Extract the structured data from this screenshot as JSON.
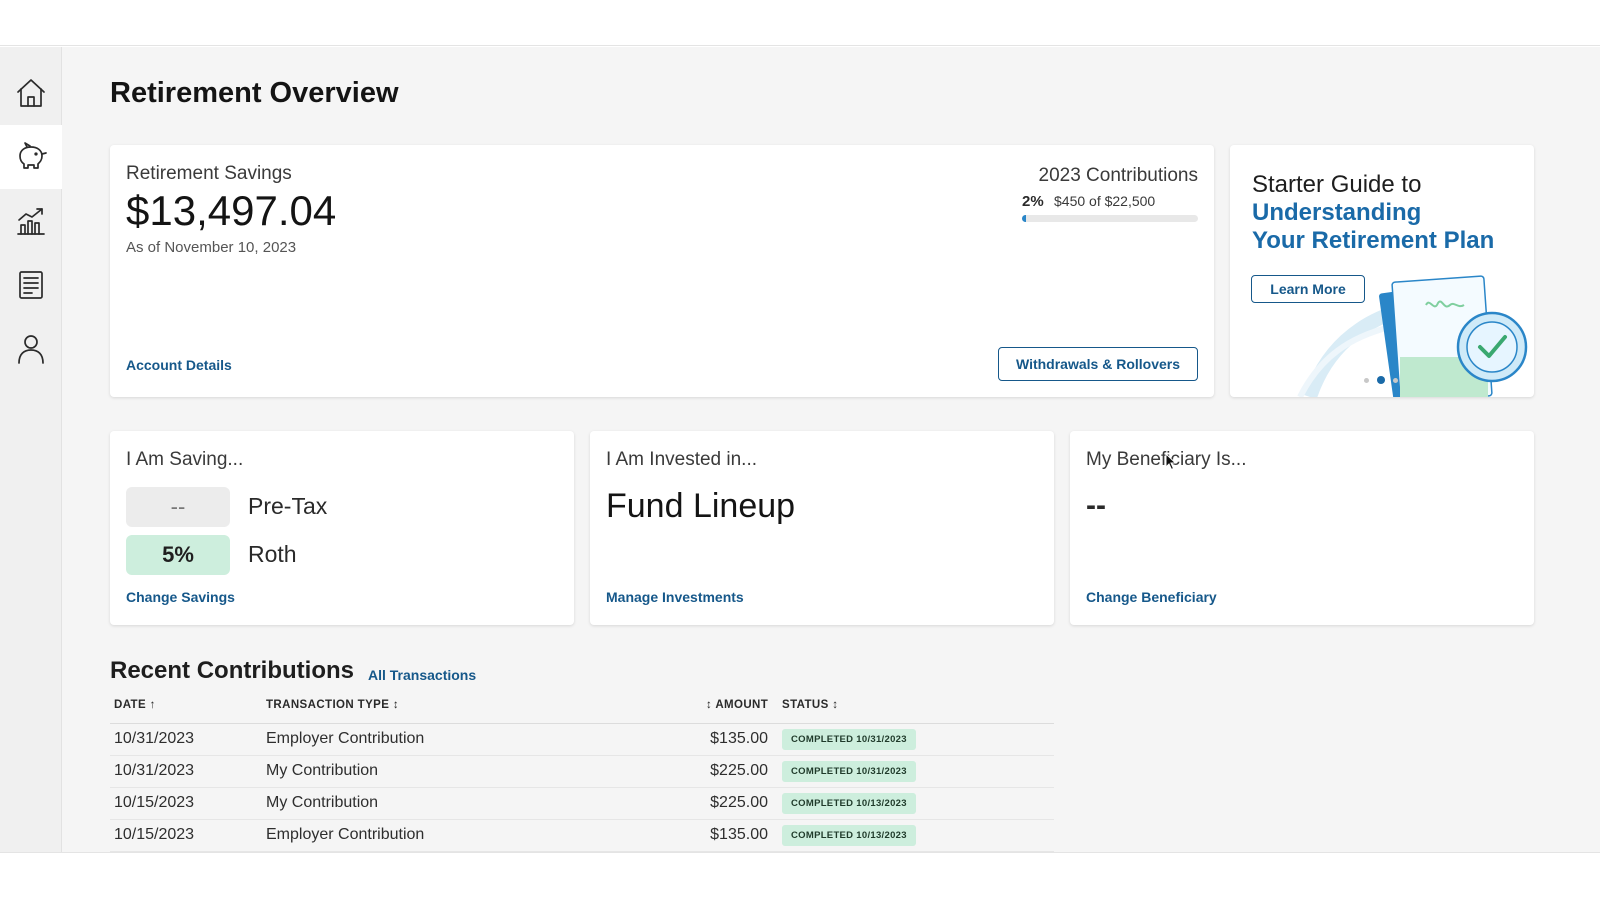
{
  "page": {
    "title": "Retirement Overview"
  },
  "sidebar": {
    "items": [
      {
        "icon": "home-icon"
      },
      {
        "icon": "piggy-bank-icon"
      },
      {
        "icon": "chart-icon"
      },
      {
        "icon": "document-icon"
      },
      {
        "icon": "user-icon"
      }
    ]
  },
  "savings": {
    "label": "Retirement Savings",
    "amount": "$13,497.04",
    "as_of": "As of November 10, 2023",
    "link": "Account Details",
    "contributions": {
      "title": "2023 Contributions",
      "percent": "2%",
      "amount_text": "$450 of $22,500",
      "progress": 0.02
    },
    "button": "Withdrawals & Rollovers"
  },
  "guide": {
    "title_line1": "Starter Guide to",
    "title_accent1": "Understanding",
    "title_accent2": "Your Retirement Plan",
    "button": "Learn More",
    "active_slide": 2,
    "slides": 3
  },
  "saving_card": {
    "label": "I Am Saving...",
    "pretax_value": "--",
    "pretax_label": "Pre-Tax",
    "roth_value": "5%",
    "roth_label": "Roth",
    "link": "Change Savings"
  },
  "invested_card": {
    "label": "I Am Invested in...",
    "value": "Fund Lineup",
    "link": "Manage Investments"
  },
  "beneficiary_card": {
    "label": "My Beneficiary Is...",
    "value": "--",
    "link": "Change Beneficiary"
  },
  "recent": {
    "title": "Recent Contributions",
    "link": "All Transactions",
    "columns": {
      "date": "DATE ↑",
      "type": "TRANSACTION TYPE ↕",
      "amount": "↕ AMOUNT",
      "status": "STATUS ↕"
    },
    "rows": [
      {
        "date": "10/31/2023",
        "type": "Employer Contribution",
        "amount": "$135.00",
        "status": "COMPLETED 10/31/2023"
      },
      {
        "date": "10/31/2023",
        "type": "My Contribution",
        "amount": "$225.00",
        "status": "COMPLETED 10/31/2023"
      },
      {
        "date": "10/15/2023",
        "type": "My Contribution",
        "amount": "$225.00",
        "status": "COMPLETED 10/13/2023"
      },
      {
        "date": "10/15/2023",
        "type": "Employer Contribution",
        "amount": "$135.00",
        "status": "COMPLETED 10/13/2023"
      }
    ]
  },
  "colors": {
    "brand": "#16588a",
    "accent": "#1a6aa8",
    "success_bg": "#cdeedd"
  }
}
